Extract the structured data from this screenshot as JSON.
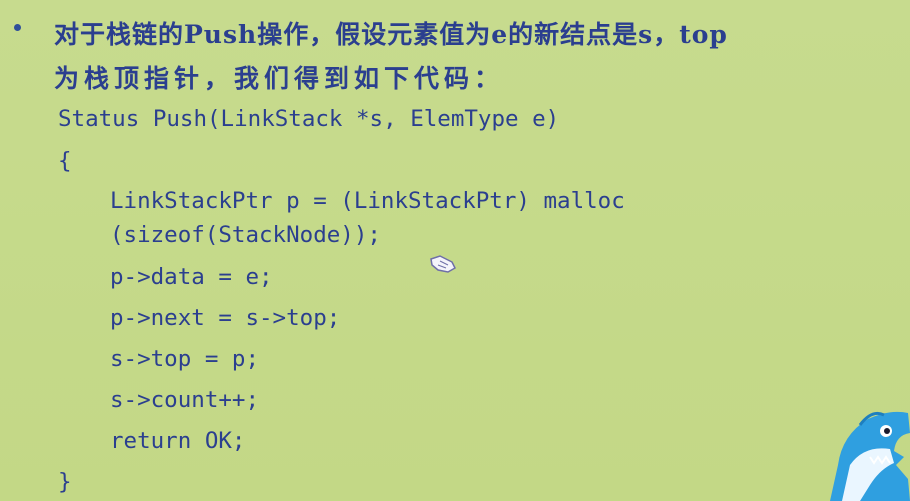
{
  "slide": {
    "bullet_text_line1": "对于栈链的Push操作，假设元素值为e的新结点是s，top",
    "bullet_text_line2": "为栈顶指针，我们得到如下代码：",
    "code_lines": [
      "Status Push(LinkStack *s, ElemType e)",
      "{",
      "LinkStackPtr p = (LinkStackPtr) malloc",
      "(sizeof(StackNode));",
      "p->data = e;",
      "p->next = s->top;",
      "s->top = p;",
      "s->count++;",
      "return OK;",
      "}"
    ]
  },
  "colors": {
    "background": "#c5d98a",
    "text": "#2b3f8f"
  },
  "icons": {
    "mascot": "shark-mascot-icon",
    "cursor": "hand-cursor-icon"
  }
}
